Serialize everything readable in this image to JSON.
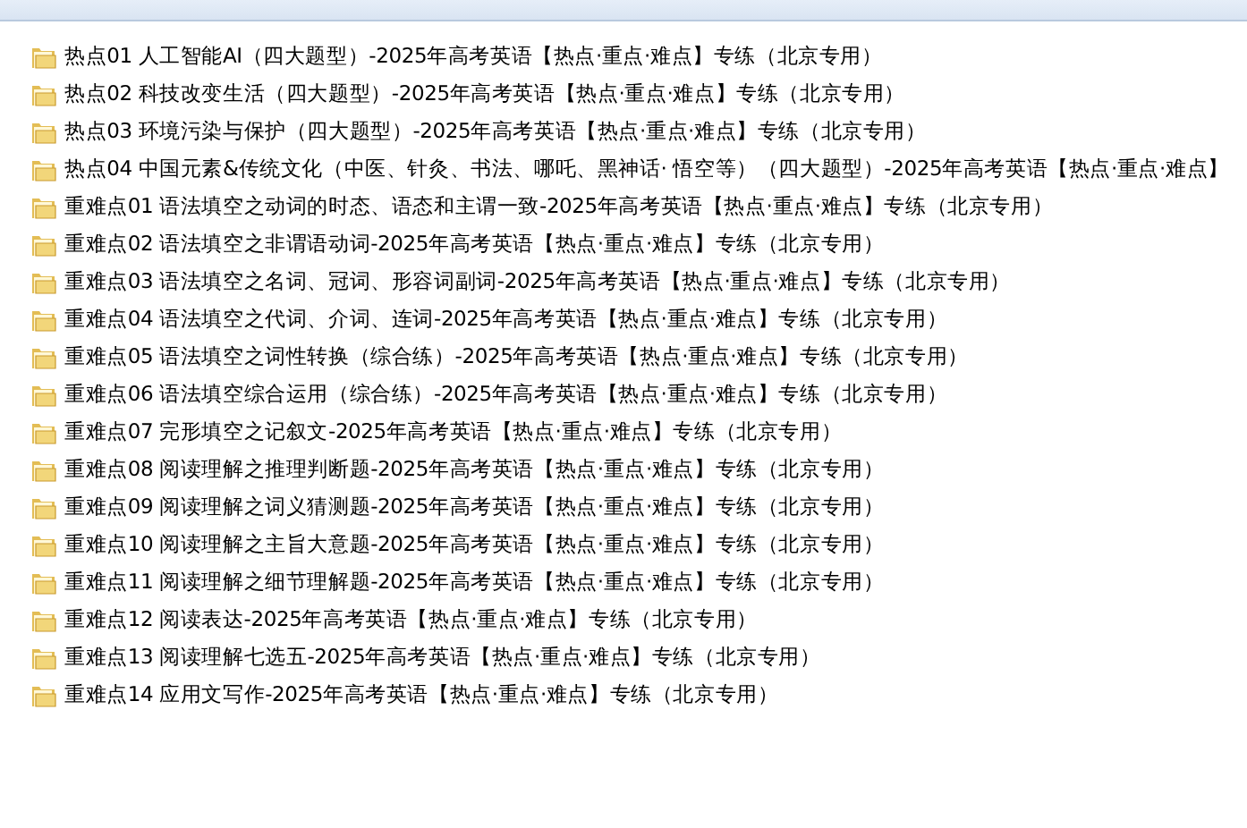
{
  "files": [
    {
      "name": "热点01 人工智能AI（四大题型）-2025年高考英语【热点·重点·难点】专练（北京专用）"
    },
    {
      "name": "热点02 科技改变生活（四大题型）-2025年高考英语【热点·重点·难点】专练（北京专用）"
    },
    {
      "name": "热点03 环境污染与保护（四大题型）-2025年高考英语【热点·重点·难点】专练（北京专用）"
    },
    {
      "name": "热点04 中国元素&传统文化（中医、针灸、书法、哪吒、黑神话· 悟空等）（四大题型）-2025年高考英语【热点·重点·难点】"
    },
    {
      "name": "重难点01 语法填空之动词的时态、语态和主谓一致-2025年高考英语【热点·重点·难点】专练（北京专用）"
    },
    {
      "name": "重难点02 语法填空之非谓语动词-2025年高考英语【热点·重点·难点】专练（北京专用）"
    },
    {
      "name": "重难点03 语法填空之名词、冠词、形容词副词-2025年高考英语【热点·重点·难点】专练（北京专用）"
    },
    {
      "name": "重难点04 语法填空之代词、介词、连词-2025年高考英语【热点·重点·难点】专练（北京专用）"
    },
    {
      "name": "重难点05 语法填空之词性转换（综合练）-2025年高考英语【热点·重点·难点】专练（北京专用）"
    },
    {
      "name": "重难点06 语法填空综合运用（综合练）-2025年高考英语【热点·重点·难点】专练（北京专用）"
    },
    {
      "name": "重难点07 完形填空之记叙文-2025年高考英语【热点·重点·难点】专练（北京专用）"
    },
    {
      "name": "重难点08 阅读理解之推理判断题-2025年高考英语【热点·重点·难点】专练（北京专用）"
    },
    {
      "name": "重难点09 阅读理解之词义猜测题-2025年高考英语【热点·重点·难点】专练（北京专用）"
    },
    {
      "name": "重难点10 阅读理解之主旨大意题-2025年高考英语【热点·重点·难点】专练（北京专用）"
    },
    {
      "name": "重难点11 阅读理解之细节理解题-2025年高考英语【热点·重点·难点】专练（北京专用）"
    },
    {
      "name": "重难点12 阅读表达-2025年高考英语【热点·重点·难点】专练（北京专用）"
    },
    {
      "name": "重难点13 阅读理解七选五-2025年高考英语【热点·重点·难点】专练（北京专用）"
    },
    {
      "name": "重难点14 应用文写作-2025年高考英语【热点·重点·难点】专练（北京专用）"
    }
  ]
}
